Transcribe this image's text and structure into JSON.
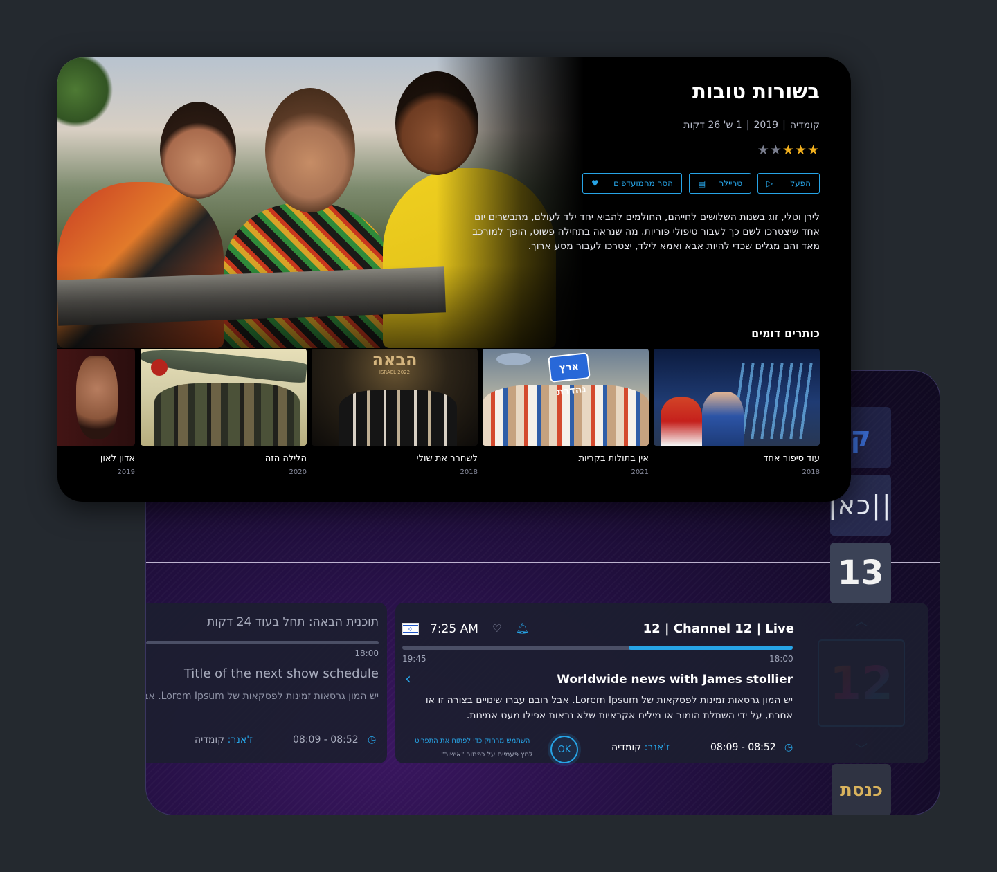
{
  "movie": {
    "title": "בשורות טובות",
    "genre": "קומדיה",
    "year": "2019",
    "duration": "1 ש' 26 דקות",
    "rating": 3,
    "rating_max": 5,
    "buttons": {
      "play": "הפעל",
      "trailer": "טריילר",
      "remove_favorites": "הסר מהמועדפים"
    },
    "description": "לירן וטלי, זוג בשנות השלושים לחייהם, החולמים להביא יחד ילד לעולם, מתבשרים יום אחד שיצטרכו לשם כך לעבור טיפולי פוריות. מה שנראה בתחילה פשוט, הופך למורכב מאד והם מגלים שכדי להיות אבא ואמא לילד, יצטרכו לעבור מסע ארוך.",
    "similar_title": "כותרים דומים",
    "similar": [
      {
        "name": "עוד סיפור אחד",
        "year": "2018"
      },
      {
        "name": "אין בתולות בקריות",
        "year": "2021"
      },
      {
        "name": "לשחרר את שולי",
        "year": "2018"
      },
      {
        "name": "הלילה הזה",
        "year": "2020"
      },
      {
        "name": "אדון לאון",
        "year": "2019"
      }
    ],
    "thumb_texts": {
      "erets_badge": "ארץ נהדרת",
      "haba_title": "הבאה",
      "haba_sub": "ISRAEL 2022"
    }
  },
  "tv": {
    "next": {
      "title": "תוכנית הבאה: תחל בעוד 24 דקות",
      "time": "18:00",
      "show": "Title of the next show schedule",
      "description": "יש המון גרסאות זמינות לפסקאות של Lorem Ipsum. אבל רובם עברו שינויים בצורה זו או אחרת, על ידי השתלת הומור או מילים אק",
      "time_range": "08:09 - 08:52",
      "genre_key": "ז'אנר:",
      "genre_value": "קומדיה"
    },
    "live": {
      "clock": "7:25 AM",
      "channel": "12 | Channel 12 | Live",
      "start": "19:45",
      "end": "18:00",
      "progress": 0.58,
      "show": "Worldwide news with James stollier",
      "description": "יש המון גרסאות זמינות לפסקאות של Lorem Ipsum. אבל רובם עברו שינויים בצורה זו או אחרת, על ידי השתלת הומור או מילים אקראיות שלא נראות אפילו מעט אמינות.",
      "time_range": "08:09 - 08:52",
      "genre_key": "ז'אנר:",
      "genre_value": "קומדיה",
      "ok_label": "OK",
      "hint_primary": "השתמש מרחוק כדי לפתוח את התפריט",
      "hint_secondary": "לחץ פעמיים על כפתור \"אישור\""
    },
    "channels": {
      "kan": "כאן||",
      "c13": "13",
      "c12": "12",
      "knesset": "כנסת",
      "ghost_top": "ק"
    },
    "colors": {
      "accent": "#27a4e6",
      "star": "#f2b01e"
    },
    "icons": {
      "heart": "heart-icon",
      "bell": "bell-icon",
      "clock": "clock-icon",
      "play": "play-icon",
      "trailer": "film-icon",
      "chevron_up": "chevron-up-icon",
      "chevron_down": "chevron-down-icon",
      "chevron_left": "chevron-left-icon",
      "flag": "israel-flag-icon"
    }
  }
}
